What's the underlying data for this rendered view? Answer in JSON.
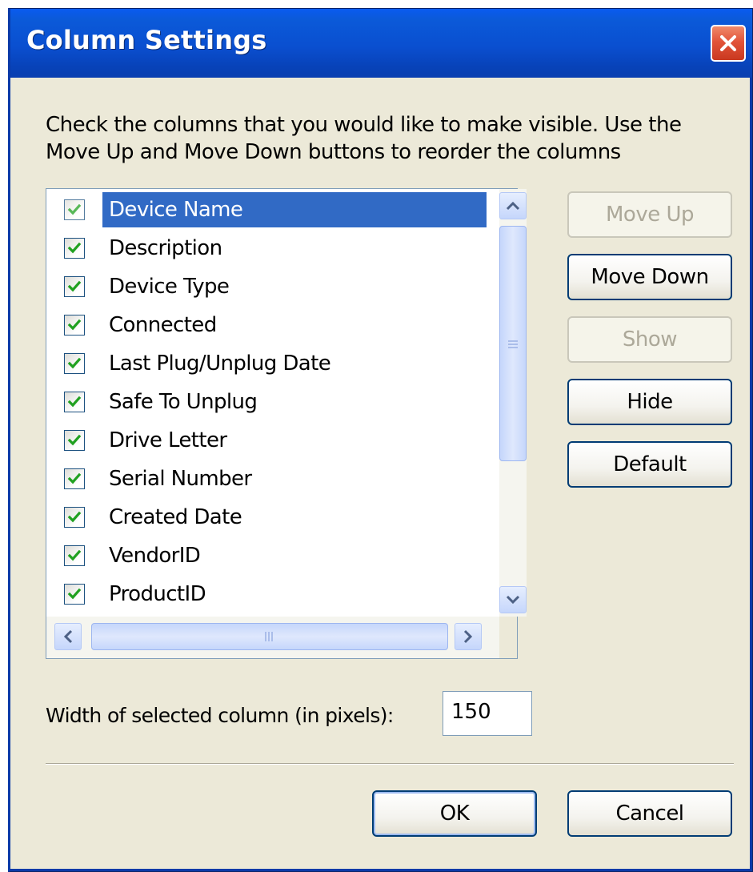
{
  "window": {
    "title": "Column Settings"
  },
  "instructions": {
    "line1": "Check the columns that you would like to make visible. Use the",
    "line2": "Move Up and Move Down buttons to reorder the columns"
  },
  "columns": [
    {
      "label": "Device Name",
      "checked": true,
      "selected": true
    },
    {
      "label": "Description",
      "checked": true,
      "selected": false
    },
    {
      "label": "Device Type",
      "checked": true,
      "selected": false
    },
    {
      "label": "Connected",
      "checked": true,
      "selected": false
    },
    {
      "label": "Last Plug/Unplug Date",
      "checked": true,
      "selected": false
    },
    {
      "label": "Safe To Unplug",
      "checked": true,
      "selected": false
    },
    {
      "label": "Drive Letter",
      "checked": true,
      "selected": false
    },
    {
      "label": "Serial Number",
      "checked": true,
      "selected": false
    },
    {
      "label": "Created Date",
      "checked": true,
      "selected": false
    },
    {
      "label": "VendorID",
      "checked": true,
      "selected": false
    },
    {
      "label": "ProductID",
      "checked": true,
      "selected": false
    }
  ],
  "buttons": {
    "move_up": {
      "label": "Move Up",
      "enabled": false
    },
    "move_down": {
      "label": "Move Down",
      "enabled": true
    },
    "show": {
      "label": "Show",
      "enabled": false
    },
    "hide": {
      "label": "Hide",
      "enabled": true
    },
    "default": {
      "label": "Default",
      "enabled": true
    },
    "ok": {
      "label": "OK"
    },
    "cancel": {
      "label": "Cancel"
    }
  },
  "width_field": {
    "label": "Width of selected column (in pixels):",
    "value": "150"
  },
  "colors": {
    "titlebar": "#0a4fd0",
    "selection": "#316ac5",
    "dialog_bg": "#ece9d8",
    "check_green": "#21a121",
    "close_red": "#e2543a"
  },
  "icons": {
    "close": "close-x-icon",
    "scroll_up": "chevron-up-icon",
    "scroll_down": "chevron-down-icon",
    "scroll_left": "chevron-left-icon",
    "scroll_right": "chevron-right-icon",
    "checkbox": "checkmark-icon"
  }
}
